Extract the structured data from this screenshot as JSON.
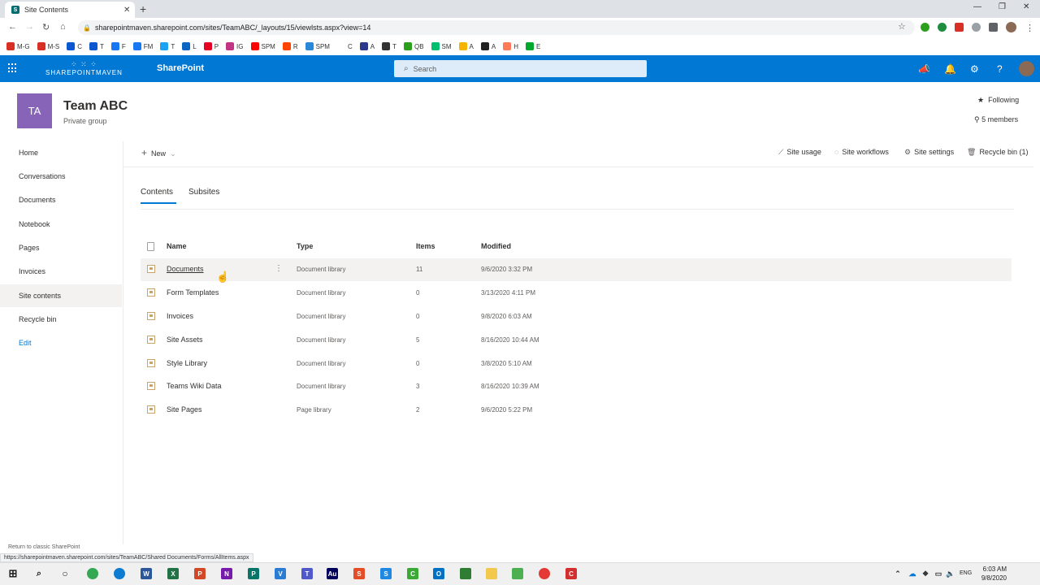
{
  "browser": {
    "tab_title": "Site Contents",
    "url": "sharepointmaven.sharepoint.com/sites/TeamABC/_layouts/15/viewlsts.aspx?view=14",
    "status_url": "https://sharepointmaven.sharepoint.com/sites/TeamABC/Shared Documents/Forms/AllItems.aspx",
    "bookmarks": [
      {
        "label": "M-G",
        "color": "#d93025"
      },
      {
        "label": "M-S",
        "color": "#d93025"
      },
      {
        "label": "C",
        "color": "#0b57d0"
      },
      {
        "label": "T",
        "color": "#0b57d0"
      },
      {
        "label": "F",
        "color": "#1877f2"
      },
      {
        "label": "FM",
        "color": "#1877f2"
      },
      {
        "label": "T",
        "color": "#1da1f2"
      },
      {
        "label": "L",
        "color": "#0a66c2"
      },
      {
        "label": "P",
        "color": "#e60023"
      },
      {
        "label": "IG",
        "color": "#c13584"
      },
      {
        "label": "SPM",
        "color": "#ff0000"
      },
      {
        "label": "R",
        "color": "#ff4500"
      },
      {
        "label": "SPM",
        "color": "#2b88d8"
      },
      {
        "label": "C",
        "color": "#ffffff"
      },
      {
        "label": "A",
        "color": "#2d3a8c"
      },
      {
        "label": "T",
        "color": "#333333"
      },
      {
        "label": "QB",
        "color": "#2ca01c"
      },
      {
        "label": "SM",
        "color": "#00bf6f"
      },
      {
        "label": "A",
        "color": "#f4b400"
      },
      {
        "label": "A",
        "color": "#222222"
      },
      {
        "label": "H",
        "color": "#ff7a59"
      },
      {
        "label": "E",
        "color": "#00a82d"
      }
    ]
  },
  "suite": {
    "logo_text": "SHAREPOINTMAVEN",
    "app_name": "SharePoint",
    "search_placeholder": "Search"
  },
  "site": {
    "logo_initials": "TA",
    "name": "Team ABC",
    "subtitle": "Private group",
    "following": "Following",
    "members": "5 members"
  },
  "nav": {
    "items": [
      "Home",
      "Conversations",
      "Documents",
      "Notebook",
      "Pages",
      "Invoices",
      "Site contents",
      "Recycle bin"
    ],
    "edit": "Edit",
    "classic": "Return to classic SharePoint"
  },
  "commands": {
    "new": "New",
    "site_usage": "Site usage",
    "site_workflows": "Site workflows",
    "site_settings": "Site settings",
    "recycle_bin": "Recycle bin (1)"
  },
  "tabs": [
    "Contents",
    "Subsites"
  ],
  "list": {
    "columns": [
      "Name",
      "Type",
      "Items",
      "Modified"
    ],
    "rows": [
      {
        "name": "Documents",
        "type": "Document library",
        "items": "11",
        "modified": "9/6/2020 3:32 PM"
      },
      {
        "name": "Form Templates",
        "type": "Document library",
        "items": "0",
        "modified": "3/13/2020 4:11 PM"
      },
      {
        "name": "Invoices",
        "type": "Document library",
        "items": "0",
        "modified": "9/8/2020 6:03 AM"
      },
      {
        "name": "Site Assets",
        "type": "Document library",
        "items": "5",
        "modified": "8/16/2020 10:44 AM"
      },
      {
        "name": "Style Library",
        "type": "Document library",
        "items": "0",
        "modified": "3/8/2020 5:10 AM"
      },
      {
        "name": "Teams Wiki Data",
        "type": "Document library",
        "items": "3",
        "modified": "8/16/2020 10:39 AM"
      },
      {
        "name": "Site Pages",
        "type": "Page library",
        "items": "2",
        "modified": "9/6/2020 5:22 PM"
      }
    ]
  },
  "taskbar": {
    "time": "6:03 AM",
    "date": "9/8/2020",
    "lang": "ENG"
  },
  "colors": {
    "suite_blue": "#0078d4",
    "site_logo": "#8764b8"
  }
}
